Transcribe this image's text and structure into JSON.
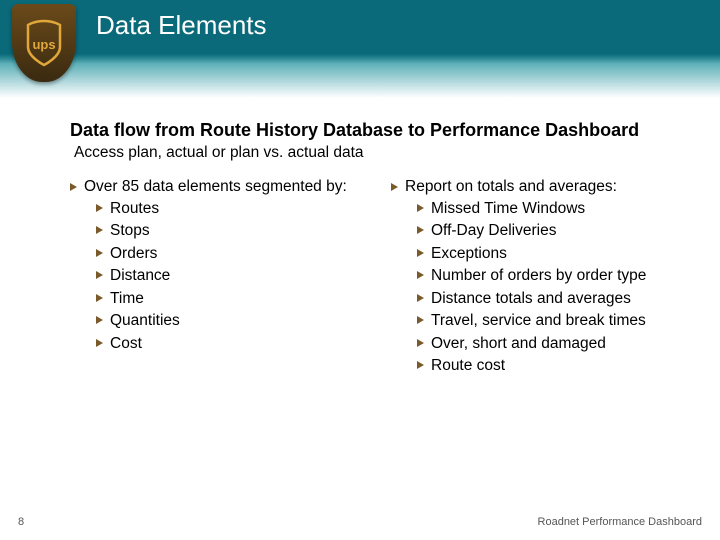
{
  "slide": {
    "title": "Data Elements",
    "heading": "Data flow from Route History Database to Performance Dashboard",
    "subheading": "Access plan, actual or plan vs. actual data",
    "left_lead": "Over 85 data elements segmented by:",
    "left_items": [
      "Routes",
      "Stops",
      "Orders",
      "Distance",
      "Time",
      "Quantities",
      "Cost"
    ],
    "right_lead": "Report on totals and averages:",
    "right_items": [
      "Missed Time Windows",
      "Off-Day Deliveries",
      "Exceptions",
      "Number of orders by order type",
      "Distance totals and averages",
      "Travel, service and break times",
      "Over, short and damaged",
      "Route cost"
    ],
    "page_number": "8",
    "footer": "Roadnet Performance Dashboard"
  }
}
